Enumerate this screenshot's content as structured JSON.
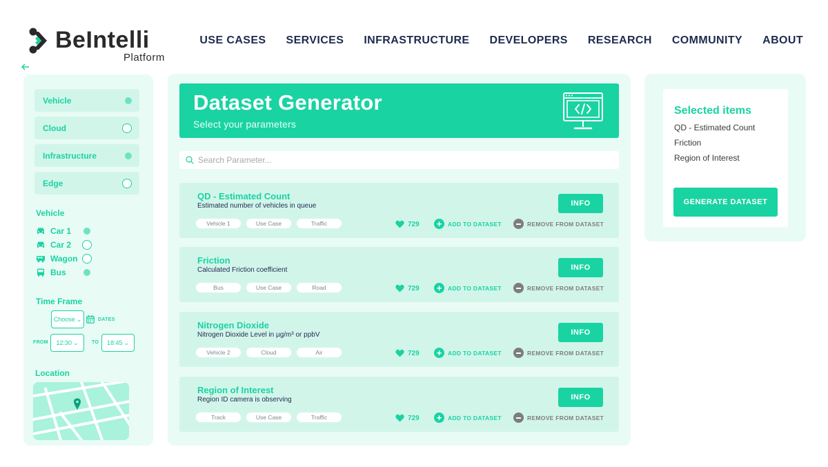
{
  "brand": {
    "name": "BeIntelli",
    "sub": "Platform"
  },
  "nav": [
    "USE CASES",
    "SERVICES",
    "INFRASTRUCTURE",
    "DEVELOPERS",
    "RESEARCH",
    "COMMUNITY",
    "ABOUT"
  ],
  "back_icon": "arrow-left-icon",
  "filters": {
    "categories": [
      {
        "label": "Vehicle",
        "selected": true
      },
      {
        "label": "Cloud",
        "selected": false
      },
      {
        "label": "Infrastructure",
        "selected": true
      },
      {
        "label": "Edge",
        "selected": false
      }
    ],
    "vehicle_title": "Vehicle",
    "vehicles": [
      {
        "label": "Car 1",
        "icon": "car-icon",
        "selected": true
      },
      {
        "label": "Car 2",
        "icon": "car-icon",
        "selected": false
      },
      {
        "label": "Wagon",
        "icon": "wagon-icon",
        "selected": false
      },
      {
        "label": "Bus",
        "icon": "bus-icon",
        "selected": true
      }
    ],
    "time_frame_title": "Time Frame",
    "choose": "Choose",
    "dates_label": "DATES",
    "from_label": "FROM",
    "from_value": "12:30",
    "to_label": "TO",
    "to_value": "18:45",
    "location_title": "Location"
  },
  "main": {
    "title": "Dataset Generator",
    "subtitle": "Select your parameters",
    "search_placeholder": "Search Parameter...",
    "info_label": "INFO",
    "add_label": "ADD TO DATASET",
    "remove_label": "REMOVE FROM DATASET",
    "cards": [
      {
        "title": "QD - Estimated Count",
        "desc": "Estimated number of vehicles in queue",
        "tags": [
          "Vehicle 1",
          "Use Case",
          "Traffic"
        ],
        "likes": "729"
      },
      {
        "title": "Friction",
        "desc": "Calculated Friction coefficient",
        "tags": [
          "Bus",
          "Use Case",
          "Road"
        ],
        "likes": "729"
      },
      {
        "title": "Nitrogen Dioxide",
        "desc": "Nitrogen Dioxide Level in µg/m³ or ppbV",
        "tags": [
          "Vehicle 2",
          "Cloud",
          "Air"
        ],
        "likes": "729"
      },
      {
        "title": "Region of Interest",
        "desc": "Region ID camera is observing",
        "tags": [
          "Track",
          "Use Case",
          "Traffic"
        ],
        "likes": "729"
      }
    ]
  },
  "selected": {
    "title": "Selected items",
    "items": [
      "QD - Estimated Count",
      "Friction",
      "Region of Interest"
    ],
    "generate_label": "GENERATE DATASET"
  },
  "colors": {
    "accent": "#19d3a2",
    "panel": "#e9fbf5",
    "card": "#d2f5ea",
    "nav_text": "#1d2b4f",
    "remove": "#7d7d7d"
  }
}
